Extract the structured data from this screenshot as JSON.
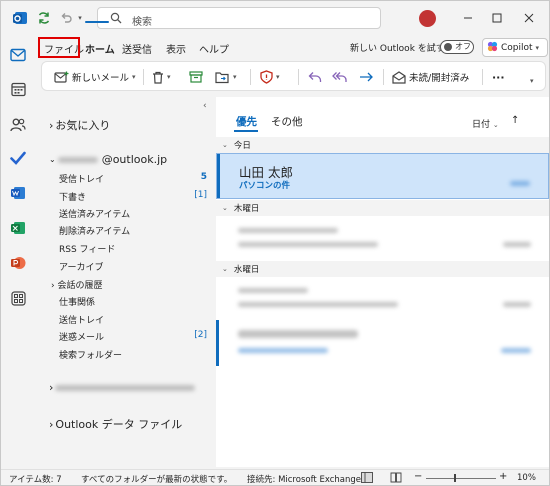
{
  "titlebar": {
    "search_placeholder": "検索"
  },
  "tabs": {
    "file": "ファイル",
    "home": "ホーム",
    "send_receive": "送受信",
    "view": "表示",
    "help": "ヘルプ",
    "new_outlook": "新しい Outlook を試す",
    "toggle_label": "オフ",
    "copilot": "Copilot"
  },
  "ribbon": {
    "new_mail": "新しいメール",
    "unread_read": "未読/開封済み",
    "more": "···"
  },
  "folders": {
    "favorites": "お気に入り",
    "account_suffix": "@outlook.jp",
    "items": [
      {
        "label": "受信トレイ",
        "count": "5"
      },
      {
        "label": "下書き",
        "count": "[1]"
      },
      {
        "label": "送信済みアイテム",
        "count": ""
      },
      {
        "label": "削除済みアイテム",
        "count": ""
      },
      {
        "label": "RSS フィード",
        "count": ""
      },
      {
        "label": "アーカイブ",
        "count": ""
      },
      {
        "label": "会話の履歴",
        "count": ""
      },
      {
        "label": "仕事関係",
        "count": ""
      },
      {
        "label": "送信トレイ",
        "count": ""
      },
      {
        "label": "迷惑メール",
        "count": "[2]"
      },
      {
        "label": "検索フォルダー",
        "count": ""
      }
    ],
    "data_file": "Outlook データ ファイル"
  },
  "list": {
    "tab_focused": "優先",
    "tab_other": "その他",
    "sort": "日付",
    "groups": {
      "today": "今日",
      "thursday": "木曜日",
      "wednesday": "水曜日"
    },
    "selected": {
      "sender": "山田 太郎",
      "subject": "パソコンの件"
    }
  },
  "status": {
    "items": "アイテム数: 7",
    "folders_state": "すべてのフォルダーが最新の状態です。",
    "connection": "接続先: Microsoft Exchange",
    "zoom": "10%"
  },
  "colors": {
    "accent": "#0f6cbd",
    "highlight_box": "#e00000",
    "selection": "#cfe4fa"
  }
}
